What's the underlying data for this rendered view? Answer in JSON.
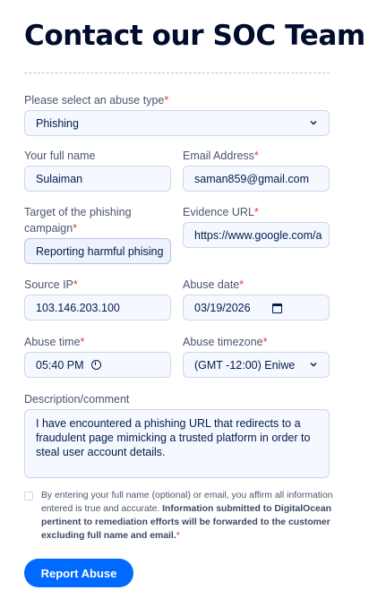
{
  "title": "Contact our SOC Team",
  "abuse_type": {
    "label": "Please select an abuse type",
    "required": "*",
    "value": "Phishing"
  },
  "full_name": {
    "label": "Your full name",
    "value": "Sulaiman"
  },
  "email": {
    "label": "Email Address",
    "required": "*",
    "value": "saman859@gmail.com"
  },
  "target": {
    "label_line1": "Target of the phishing",
    "label_line2": "campaign",
    "required": "*",
    "value": "Reporting harmful phising"
  },
  "evidence_url": {
    "label": "Evidence URL",
    "required": "*",
    "value": "https://www.google.com/a"
  },
  "source_ip": {
    "label": "Source IP",
    "required": "*",
    "value": "103.146.203.100"
  },
  "abuse_date": {
    "label": "Abuse date",
    "required": "*",
    "value": "03/19/2026"
  },
  "abuse_time": {
    "label": "Abuse time",
    "required": "*",
    "value": "05:40 PM"
  },
  "timezone": {
    "label": "Abuse timezone",
    "required": "*",
    "value": "(GMT -12:00) Eniwe"
  },
  "description": {
    "label": "Description/comment",
    "value": "I have encountered a phishing URL that redirects to a fraudulent page mimicking a trusted platform in order to steal user account details."
  },
  "consent": {
    "text_plain": "By entering your full name (optional) or email, you affirm all information entered is true and accurate. ",
    "text_bold": "Information submitted to DigitalOcean pertinent to remediation efforts will be forwarded to the customer excluding full name and email.",
    "required": "*"
  },
  "submit_label": "Report Abuse",
  "colors": {
    "primary": "#0069ff",
    "required": "#e5334b",
    "heading": "#000c2b"
  }
}
